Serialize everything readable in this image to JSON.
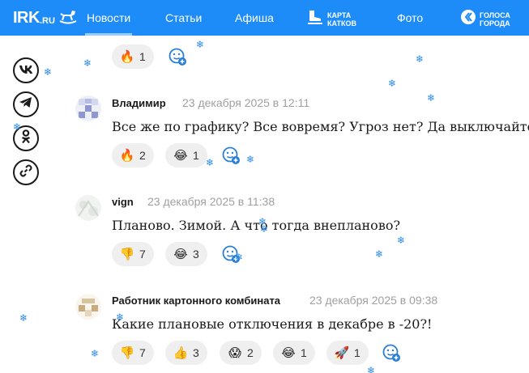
{
  "header": {
    "logo_main": "IRK",
    "logo_sub": ".RU",
    "nav": [
      {
        "label": "Новости",
        "active": true
      },
      {
        "label": "Статьи"
      },
      {
        "label": "Афиша"
      },
      {
        "label": "Фото"
      }
    ],
    "special_rink": "КАРТА\nКАТКОВ",
    "special_voices": "ГОЛОСА\nГОРОДА"
  },
  "share": [
    "vk-icon",
    "telegram-icon",
    "odnoklassniki-icon",
    "link-icon"
  ],
  "top_reactions": [
    {
      "emoji": "🔥",
      "count": "1"
    }
  ],
  "comments": [
    {
      "author": "Владимир",
      "date": "23 декабря 2025 в 12:11",
      "text": "Все же по графику? Все вовремя? Угроз нет? Да выключайте,",
      "reactions": [
        {
          "emoji": "🔥",
          "count": "2"
        },
        {
          "emoji": "😂",
          "count": "1"
        }
      ]
    },
    {
      "author": "vign",
      "date": "23 декабря 2025 в 11:38",
      "text": "Планово. Зимой. А что тогда внепланово?",
      "reactions": [
        {
          "emoji": "👎",
          "count": "7"
        },
        {
          "emoji": "😂",
          "count": "3"
        }
      ]
    },
    {
      "author": "Работник картонного комбината",
      "date": "23 декабря 2025 в 09:38",
      "text": "Какие плановые отключения в декабре в -20?!",
      "reactions": [
        {
          "emoji": "👎",
          "count": "7"
        },
        {
          "emoji": "👍",
          "count": "3"
        },
        {
          "emoji": "😱",
          "count": "2"
        },
        {
          "emoji": "😂",
          "count": "1"
        },
        {
          "emoji": "🚀",
          "count": "1"
        }
      ]
    }
  ],
  "colors": {
    "brand_blue": "#1d8cf8",
    "chip_bg": "#efefef",
    "date_gray": "#a0a0a0",
    "snow": "#2a8ae8"
  }
}
